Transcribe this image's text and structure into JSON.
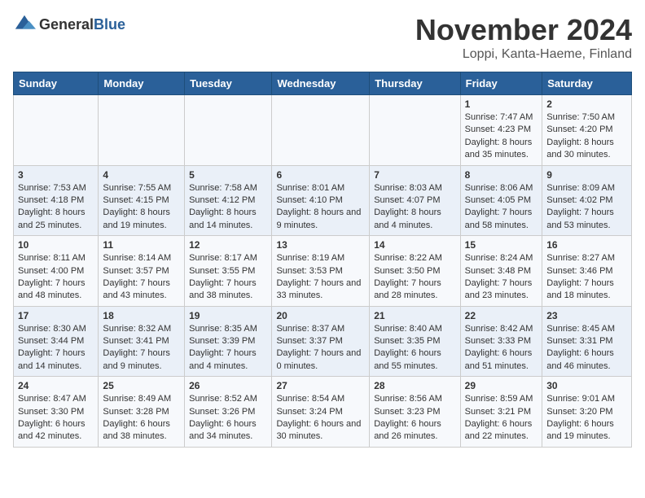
{
  "header": {
    "logo_general": "General",
    "logo_blue": "Blue",
    "month": "November 2024",
    "location": "Loppi, Kanta-Haeme, Finland"
  },
  "days_of_week": [
    "Sunday",
    "Monday",
    "Tuesday",
    "Wednesday",
    "Thursday",
    "Friday",
    "Saturday"
  ],
  "weeks": [
    [
      {
        "day": "",
        "info": ""
      },
      {
        "day": "",
        "info": ""
      },
      {
        "day": "",
        "info": ""
      },
      {
        "day": "",
        "info": ""
      },
      {
        "day": "",
        "info": ""
      },
      {
        "day": "1",
        "info": "Sunrise: 7:47 AM\nSunset: 4:23 PM\nDaylight: 8 hours and 35 minutes."
      },
      {
        "day": "2",
        "info": "Sunrise: 7:50 AM\nSunset: 4:20 PM\nDaylight: 8 hours and 30 minutes."
      }
    ],
    [
      {
        "day": "3",
        "info": "Sunrise: 7:53 AM\nSunset: 4:18 PM\nDaylight: 8 hours and 25 minutes."
      },
      {
        "day": "4",
        "info": "Sunrise: 7:55 AM\nSunset: 4:15 PM\nDaylight: 8 hours and 19 minutes."
      },
      {
        "day": "5",
        "info": "Sunrise: 7:58 AM\nSunset: 4:12 PM\nDaylight: 8 hours and 14 minutes."
      },
      {
        "day": "6",
        "info": "Sunrise: 8:01 AM\nSunset: 4:10 PM\nDaylight: 8 hours and 9 minutes."
      },
      {
        "day": "7",
        "info": "Sunrise: 8:03 AM\nSunset: 4:07 PM\nDaylight: 8 hours and 4 minutes."
      },
      {
        "day": "8",
        "info": "Sunrise: 8:06 AM\nSunset: 4:05 PM\nDaylight: 7 hours and 58 minutes."
      },
      {
        "day": "9",
        "info": "Sunrise: 8:09 AM\nSunset: 4:02 PM\nDaylight: 7 hours and 53 minutes."
      }
    ],
    [
      {
        "day": "10",
        "info": "Sunrise: 8:11 AM\nSunset: 4:00 PM\nDaylight: 7 hours and 48 minutes."
      },
      {
        "day": "11",
        "info": "Sunrise: 8:14 AM\nSunset: 3:57 PM\nDaylight: 7 hours and 43 minutes."
      },
      {
        "day": "12",
        "info": "Sunrise: 8:17 AM\nSunset: 3:55 PM\nDaylight: 7 hours and 38 minutes."
      },
      {
        "day": "13",
        "info": "Sunrise: 8:19 AM\nSunset: 3:53 PM\nDaylight: 7 hours and 33 minutes."
      },
      {
        "day": "14",
        "info": "Sunrise: 8:22 AM\nSunset: 3:50 PM\nDaylight: 7 hours and 28 minutes."
      },
      {
        "day": "15",
        "info": "Sunrise: 8:24 AM\nSunset: 3:48 PM\nDaylight: 7 hours and 23 minutes."
      },
      {
        "day": "16",
        "info": "Sunrise: 8:27 AM\nSunset: 3:46 PM\nDaylight: 7 hours and 18 minutes."
      }
    ],
    [
      {
        "day": "17",
        "info": "Sunrise: 8:30 AM\nSunset: 3:44 PM\nDaylight: 7 hours and 14 minutes."
      },
      {
        "day": "18",
        "info": "Sunrise: 8:32 AM\nSunset: 3:41 PM\nDaylight: 7 hours and 9 minutes."
      },
      {
        "day": "19",
        "info": "Sunrise: 8:35 AM\nSunset: 3:39 PM\nDaylight: 7 hours and 4 minutes."
      },
      {
        "day": "20",
        "info": "Sunrise: 8:37 AM\nSunset: 3:37 PM\nDaylight: 7 hours and 0 minutes."
      },
      {
        "day": "21",
        "info": "Sunrise: 8:40 AM\nSunset: 3:35 PM\nDaylight: 6 hours and 55 minutes."
      },
      {
        "day": "22",
        "info": "Sunrise: 8:42 AM\nSunset: 3:33 PM\nDaylight: 6 hours and 51 minutes."
      },
      {
        "day": "23",
        "info": "Sunrise: 8:45 AM\nSunset: 3:31 PM\nDaylight: 6 hours and 46 minutes."
      }
    ],
    [
      {
        "day": "24",
        "info": "Sunrise: 8:47 AM\nSunset: 3:30 PM\nDaylight: 6 hours and 42 minutes."
      },
      {
        "day": "25",
        "info": "Sunrise: 8:49 AM\nSunset: 3:28 PM\nDaylight: 6 hours and 38 minutes."
      },
      {
        "day": "26",
        "info": "Sunrise: 8:52 AM\nSunset: 3:26 PM\nDaylight: 6 hours and 34 minutes."
      },
      {
        "day": "27",
        "info": "Sunrise: 8:54 AM\nSunset: 3:24 PM\nDaylight: 6 hours and 30 minutes."
      },
      {
        "day": "28",
        "info": "Sunrise: 8:56 AM\nSunset: 3:23 PM\nDaylight: 6 hours and 26 minutes."
      },
      {
        "day": "29",
        "info": "Sunrise: 8:59 AM\nSunset: 3:21 PM\nDaylight: 6 hours and 22 minutes."
      },
      {
        "day": "30",
        "info": "Sunrise: 9:01 AM\nSunset: 3:20 PM\nDaylight: 6 hours and 19 minutes."
      }
    ]
  ]
}
